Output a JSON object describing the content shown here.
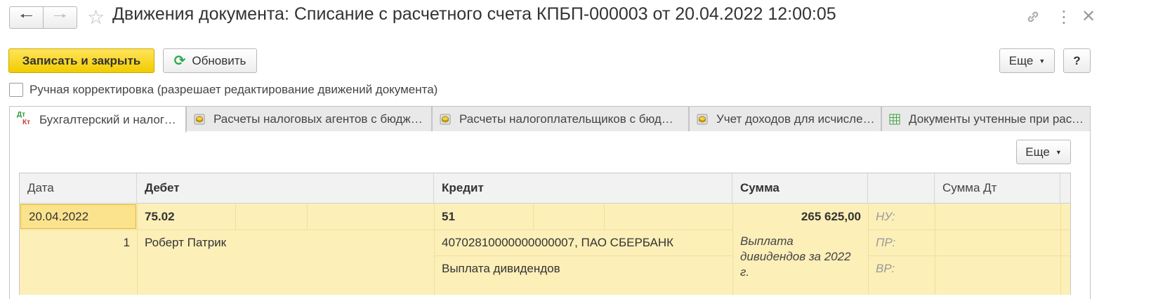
{
  "window": {
    "title": "Движения документа: Списание с расчетного счета КПБП-000003 от 20.04.2022 12:00:05"
  },
  "toolbar": {
    "save_close": "Записать и закрыть",
    "refresh": "Обновить",
    "more": "Еще",
    "help": "?"
  },
  "manual": {
    "label": "Ручная корректировка (разрешает редактирование движений документа)"
  },
  "tabs": [
    {
      "label": "Бухгалтерский и налоговый учет",
      "icon": "dt-kt-icon",
      "active": true
    },
    {
      "label": "Расчеты налоговых агентов с бюджетом",
      "icon": "coins-icon",
      "active": false
    },
    {
      "label": "Расчеты налогоплательщиков с бюджетом",
      "icon": "coins-icon",
      "active": false
    },
    {
      "label": "Учет доходов для исчисления",
      "icon": "coins-icon",
      "active": false
    },
    {
      "label": "Документы учтенные при расчете",
      "icon": "table-icon",
      "active": false
    }
  ],
  "dtkt": {
    "dt": "Дт",
    "kt": "Кт"
  },
  "grid": {
    "more": "Еще",
    "headers": {
      "date": "Дата",
      "debit": "Дебет",
      "credit": "Кредит",
      "sum": "Сумма",
      "sum_dt": "Сумма Дт"
    },
    "row": {
      "date": "20.04.2022",
      "num": "1",
      "debit_account": "75.02",
      "debit_subconto": "Роберт Патрик",
      "credit_account": "51",
      "credit_subconto1": "40702810000000000007, ПАО СБЕРБАНК",
      "credit_subconto2": "Выплата дивидендов",
      "sum": "265 625,00",
      "content_l1": "Выплата",
      "content_l2": "дивидендов за 2022",
      "content_l3": "г.",
      "nu": "НУ:",
      "pr": "ПР:",
      "vr": "ВР:"
    }
  },
  "colors": {
    "accent_yellow": "#f5d31b",
    "row_highlight": "#fcefb8",
    "selected_cell": "#fbe38e",
    "refresh_green": "#2fa84f",
    "dtkt_green": "#2e9b3a",
    "dtkt_red": "#d33a2c"
  }
}
